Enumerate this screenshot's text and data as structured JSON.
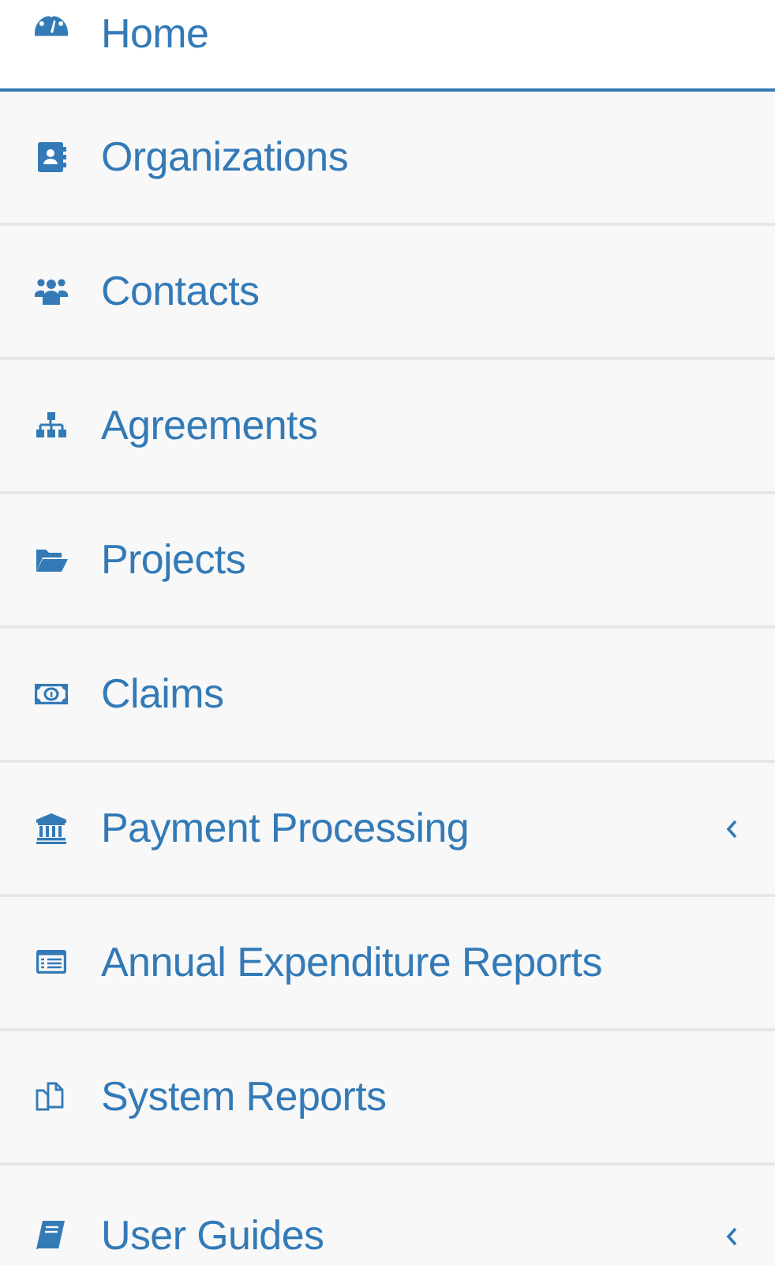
{
  "sidebar": {
    "items": [
      {
        "label": "Home",
        "selected": true,
        "has_submenu": false
      },
      {
        "label": "Organizations",
        "selected": false,
        "has_submenu": false
      },
      {
        "label": "Contacts",
        "selected": false,
        "has_submenu": false
      },
      {
        "label": "Agreements",
        "selected": false,
        "has_submenu": false
      },
      {
        "label": "Projects",
        "selected": false,
        "has_submenu": false
      },
      {
        "label": "Claims",
        "selected": false,
        "has_submenu": false
      },
      {
        "label": "Payment Processing",
        "selected": false,
        "has_submenu": true
      },
      {
        "label": "Annual Expenditure Reports",
        "selected": false,
        "has_submenu": false
      },
      {
        "label": "System Reports",
        "selected": false,
        "has_submenu": false
      },
      {
        "label": "User Guides",
        "selected": false,
        "has_submenu": true
      }
    ]
  }
}
